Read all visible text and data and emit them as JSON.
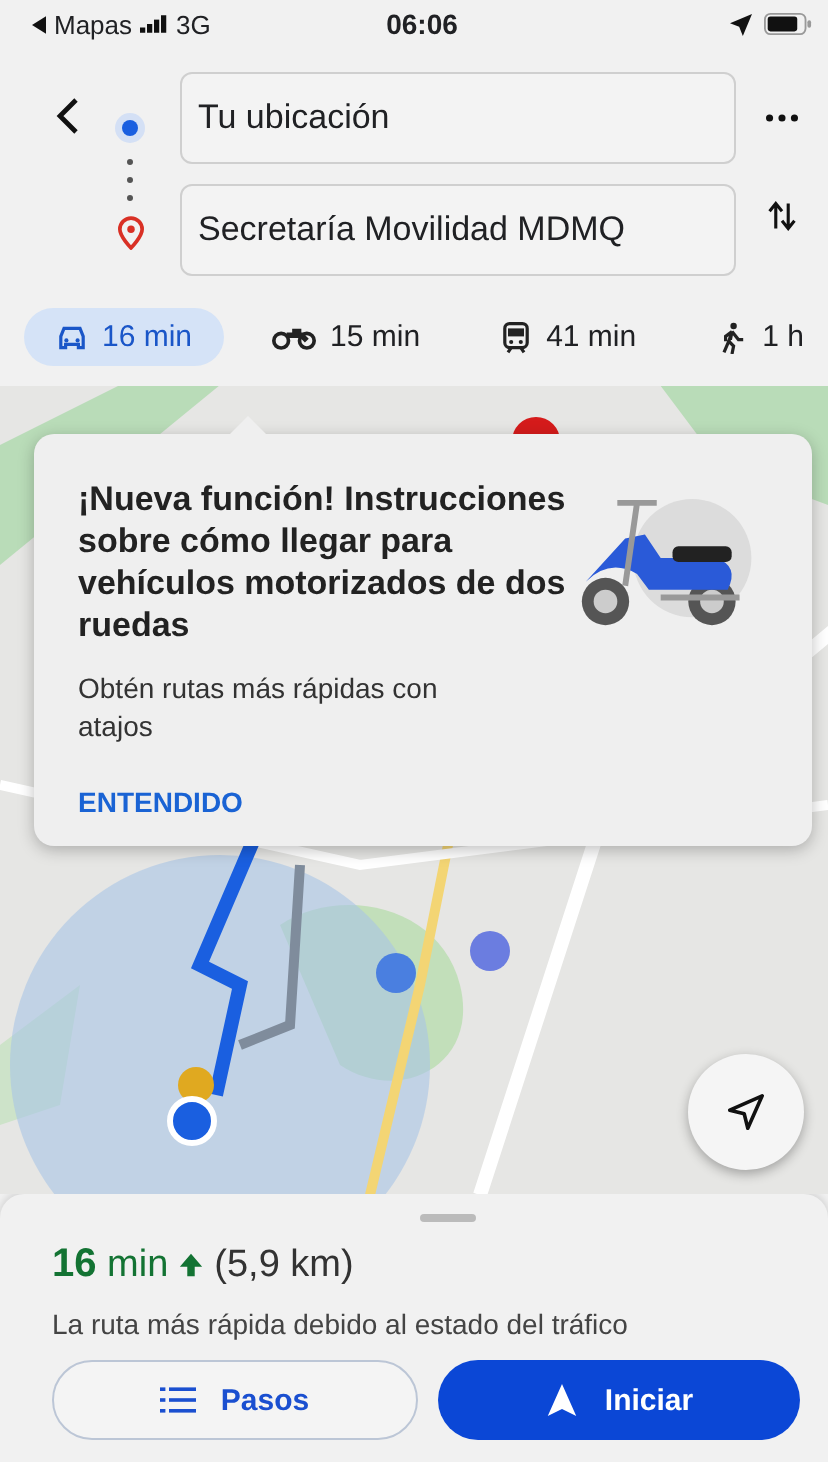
{
  "status_bar": {
    "back_app": "Mapas",
    "network": "3G",
    "time": "06:06"
  },
  "route": {
    "origin": "Tu ubicación",
    "destination": "Secretaría Movilidad MDMQ"
  },
  "modes": [
    {
      "kind": "car",
      "label": "16 min",
      "selected": true
    },
    {
      "kind": "motorcycle",
      "label": "15 min",
      "selected": false
    },
    {
      "kind": "transit",
      "label": "41 min",
      "selected": false
    },
    {
      "kind": "walk",
      "label": "1 h",
      "selected": false
    }
  ],
  "promo": {
    "title": "¡Nueva función! Instrucciones sobre cómo llegar para vehículos motorizados de dos ruedas",
    "body": "Obtén rutas más rápidas con atajos",
    "action": "ENTENDIDO"
  },
  "summary": {
    "duration": "**16** min",
    "distance": "(5,9 km)",
    "note": "La ruta más rápida debido al estado del tráfico"
  },
  "buttons": [
    {
      "kind": "steps",
      "label": "Pasos"
    },
    {
      "kind": "start",
      "label": "Iniciar"
    }
  ]
}
